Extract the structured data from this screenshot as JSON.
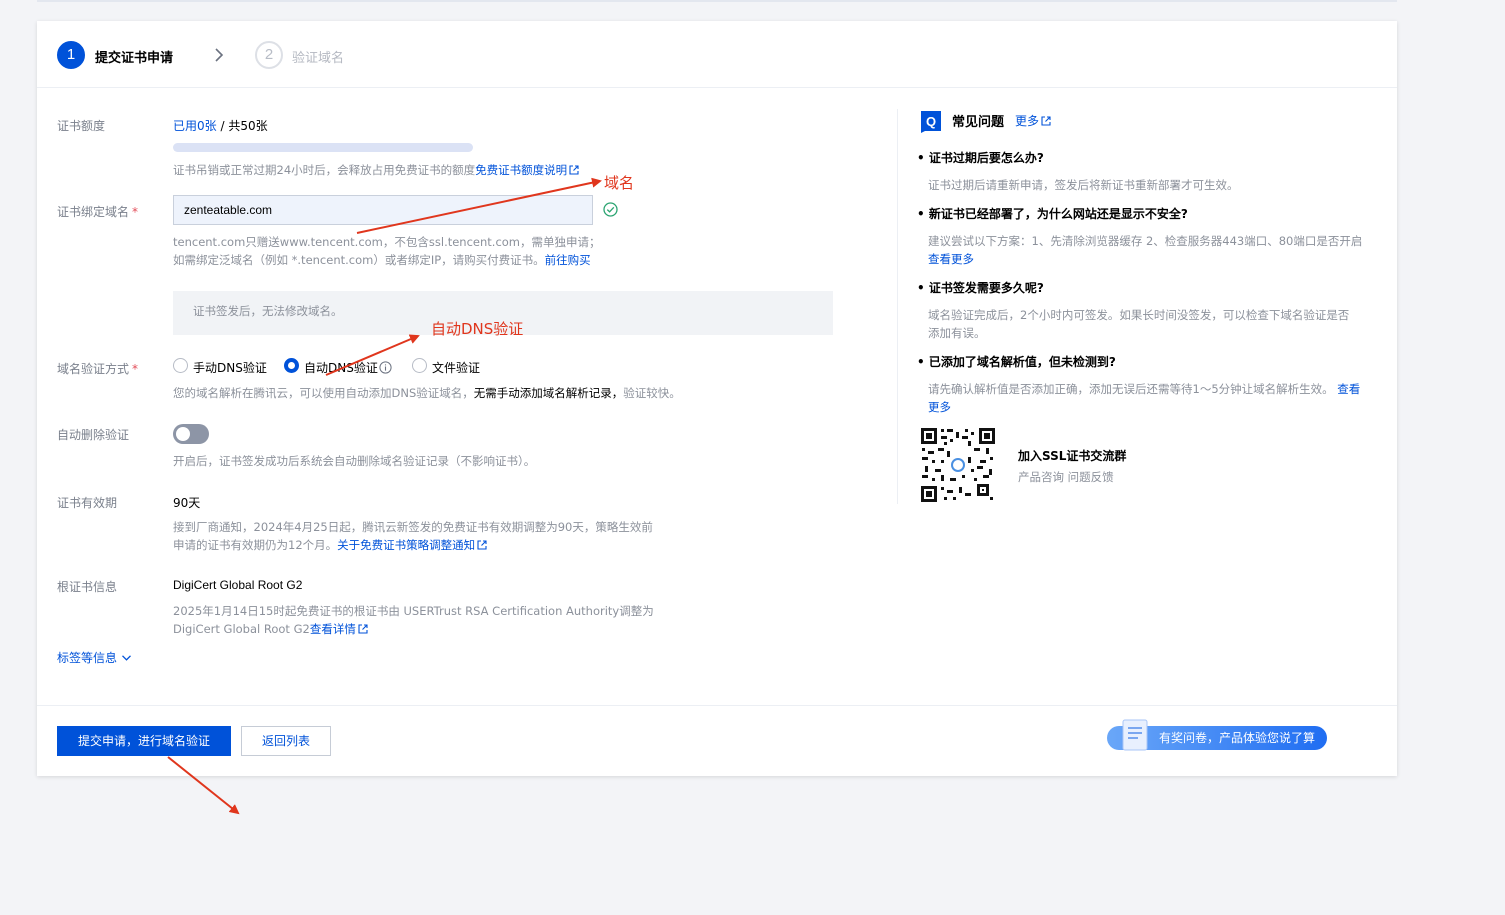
{
  "steps": [
    {
      "number": "1",
      "label": "提交证书申请"
    },
    {
      "number": "2",
      "label": "验证域名"
    }
  ],
  "form": {
    "quota": {
      "label": "证书额度",
      "used": "已用0张",
      "sep": " / ",
      "total": "共50张",
      "usage_fraction": 0,
      "hint_prefix": "证书吊销或正常过期24小时后，会释放占用免费证书的额度",
      "hint_link": "免费证书额度说明"
    },
    "domain": {
      "label": "证书绑定域名",
      "required": "*",
      "value": "zenteatable.com",
      "hint_line1": "tencent.com只赠送www.tencent.com，不包含ssl.tencent.com，需单独申请；",
      "hint_line2_prefix": "如需绑定泛域名（例如 *.tencent.com）或者绑定IP，请购买付费证书。",
      "hint_line2_link": "前往购买",
      "notice": "证书签发后，无法修改域名。"
    },
    "verify": {
      "label": "域名验证方式",
      "required": "*",
      "options": [
        "手动DNS验证",
        "自动DNS验证",
        "文件验证"
      ],
      "selected": "自动DNS验证",
      "hint_prefix": "您的域名解析在腾讯云，可以使用自动添加DNS验证域名，",
      "hint_bold": "无需手动添加域名解析记录，",
      "hint_suffix": "验证较快。"
    },
    "auto_delete": {
      "label": "自动删除验证",
      "enabled": false,
      "hint": "开启后，证书签发成功后系统会自动删除域名验证记录（不影响证书）。"
    },
    "validity": {
      "label": "证书有效期",
      "value": "90天",
      "hint_line1": "接到厂商通知，2024年4月25日起，腾讯云新签发的免费证书有效期调整为90天，策略生效前",
      "hint_line2_prefix": "申请的证书有效期仍为12个月。",
      "hint_line2_link": "关于免费证书策略调整通知"
    },
    "root_cert": {
      "label": "根证书信息",
      "value": "DigiCert Global Root G2",
      "hint_line1": "2025年1月14日15时起免费证书的根证书由 USERTrust RSA Certification Authority调整为",
      "hint_line2_prefix": "DigiCert Global Root G2",
      "hint_line2_link": "查看详情"
    },
    "tags_toggle": "标签等信息"
  },
  "footer": {
    "submit": "提交申请，进行域名验证",
    "back": "返回列表",
    "survey": "有奖问卷，产品体验您说了算"
  },
  "faq": {
    "title": "常见问题",
    "more": "更多",
    "items": [
      {
        "q": "证书过期后要怎么办?",
        "a": "证书过期后请重新申请，签发后将新证书重新部署才可生效。"
      },
      {
        "q": "新证书已经部署了，为什么网站还是显示不安全?",
        "a_line1": "建议尝试以下方案：1、先清除浏览器缓存 2、检查服务器443端口、80端口是否开启",
        "a_link": "查看更多"
      },
      {
        "q": "证书签发需要多久呢?",
        "a_line1": "域名验证完成后，2个小时内可签发。如果长时间没签发，可以检查下域名验证是否",
        "a_line2": "添加有误。"
      },
      {
        "q": "已添加了域名解析值，但未检测到?",
        "a_line1": "请先确认解析值是否添加正确，添加无误后还需等待1～5分钟让域名解析生效。",
        "a_link1": "查看",
        "a_link2": "更多"
      }
    ],
    "group_title": "加入SSL证书交流群",
    "group_sub": "产品咨询 问题反馈"
  },
  "annotations": {
    "domain": "域名",
    "auto_dns": "自动DNS验证"
  },
  "colors": {
    "primary": "#0052d9",
    "annotation": "#e0361d",
    "success": "#2ba471"
  }
}
